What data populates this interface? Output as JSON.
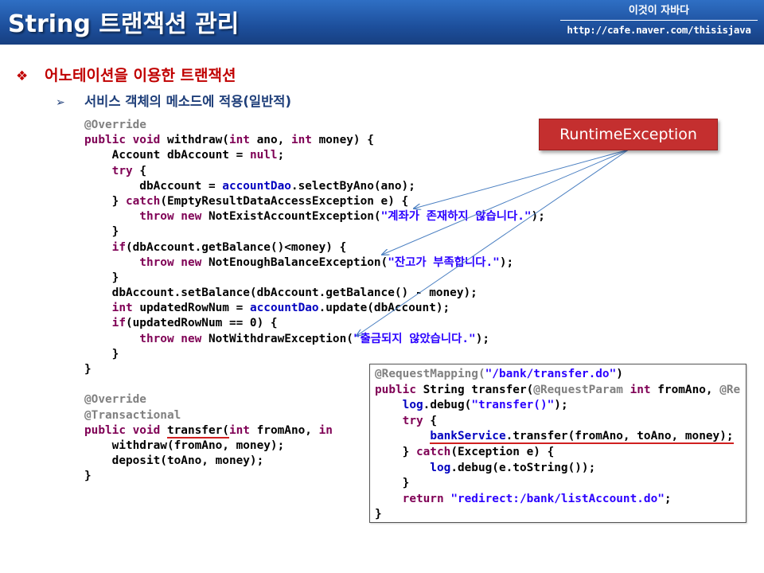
{
  "header": {
    "title": "String 트랜잭션 관리",
    "brand_name": "이것이 자바다",
    "brand_url": "http://cafe.naver.com/thisisjava"
  },
  "bullets": {
    "level1_mark": "❖",
    "level1": "어노테이션을 이용한 트랜잭션",
    "level2_mark": "➢",
    "level2": "서비스 객체의 메소드에 적용(일반적)"
  },
  "callout": {
    "label": "RuntimeException"
  },
  "code_main": {
    "l1": "@Override",
    "l2_kw": "public void",
    "l2_rest_a": " withdraw(",
    "l2_kw2": "int",
    "l2_rest_b": " ano, ",
    "l2_kw3": "int",
    "l2_rest_c": " money) {",
    "l3_a": "    Account dbAccount = ",
    "l3_kw": "null",
    "l3_b": ";",
    "l4_kw": "    try",
    "l4_b": " {",
    "l5_a": "        dbAccount = ",
    "l5_fld": "accountDao",
    "l5_b": ".selectByAno(ano);",
    "l6_a": "    } ",
    "l6_kw": "catch",
    "l6_b": "(EmptyResultDataAccessException e) {",
    "l7_kw": "        throw new",
    "l7_b": " NotExistAccountException(",
    "l7_str": "\"계좌가 존재하지 않습니다.\"",
    "l7_c": ");",
    "l8": "    }",
    "l9_kw": "    if",
    "l9_b": "(dbAccount.getBalance()<money) {",
    "l10_kw": "        throw new",
    "l10_b": " NotEnoughBalanceException(",
    "l10_str": "\"잔고가 부족합니다.\"",
    "l10_c": ");",
    "l11": "    }",
    "l12": "    dbAccount.setBalance(dbAccount.getBalance() - money);",
    "l13_kw": "    int",
    "l13_b": " updatedRowNum = ",
    "l13_fld": "accountDao",
    "l13_c": ".update(dbAccount);",
    "l14_kw": "    if",
    "l14_b": "(updatedRowNum == 0) {",
    "l15_kw": "        throw new",
    "l15_b": " NotWithdrawException(",
    "l15_str": "\"출금되지 않았습니다.\"",
    "l15_c": ");",
    "l16": "    }",
    "l17": "}",
    "l18": "",
    "l19": "@Override",
    "l20": "@Transactional",
    "l21_kw": "public void",
    "l21_b": " ",
    "l21_ul": "transfer(",
    "l21_kw2": "int",
    "l21_c": " fromAno, ",
    "l21_kw3": "in",
    "l22": "    withdraw(fromAno, money);",
    "l23": "    deposit(toAno, money);",
    "l24": "}"
  },
  "code_inset": {
    "l1_ann": "@RequestMapping(",
    "l1_str": "\"/bank/transfer.do\"",
    "l1_b": ")",
    "l2_kw": "public",
    "l2_b": " String transfer(",
    "l2_ann": "@RequestParam",
    "l2_c": " ",
    "l2_kw2": "int",
    "l2_d": " fromAno, ",
    "l2_ann2": "@Re",
    "l3_fld": "    log",
    "l3_b": ".debug(",
    "l3_str": "\"transfer()\"",
    "l3_c": ");",
    "l4_kw": "    try",
    "l4_b": " {",
    "l5_fld": "bankService",
    "l5_b": ".transfer(fromAno, toAno, money);",
    "l6_a": "    } ",
    "l6_kw": "catch",
    "l6_b": "(Exception e) {",
    "l7_fld": "        log",
    "l7_b": ".debug(e.toString());",
    "l8": "    }",
    "l9_kw": "    return",
    "l9_b": " ",
    "l9_str": "\"redirect:/bank/listAccount.do\"",
    "l9_c": ";",
    "l10": "}"
  },
  "colors": {
    "header_bg": "#1d4f9c",
    "accent_red": "#c00000",
    "subheading": "#1f3f7a",
    "callout_bg": "#c42f2f",
    "keyword": "#7f0055",
    "field": "#0000c0",
    "string": "#2a00ff",
    "annotation": "#808080",
    "arrow": "#4a7fc1"
  }
}
